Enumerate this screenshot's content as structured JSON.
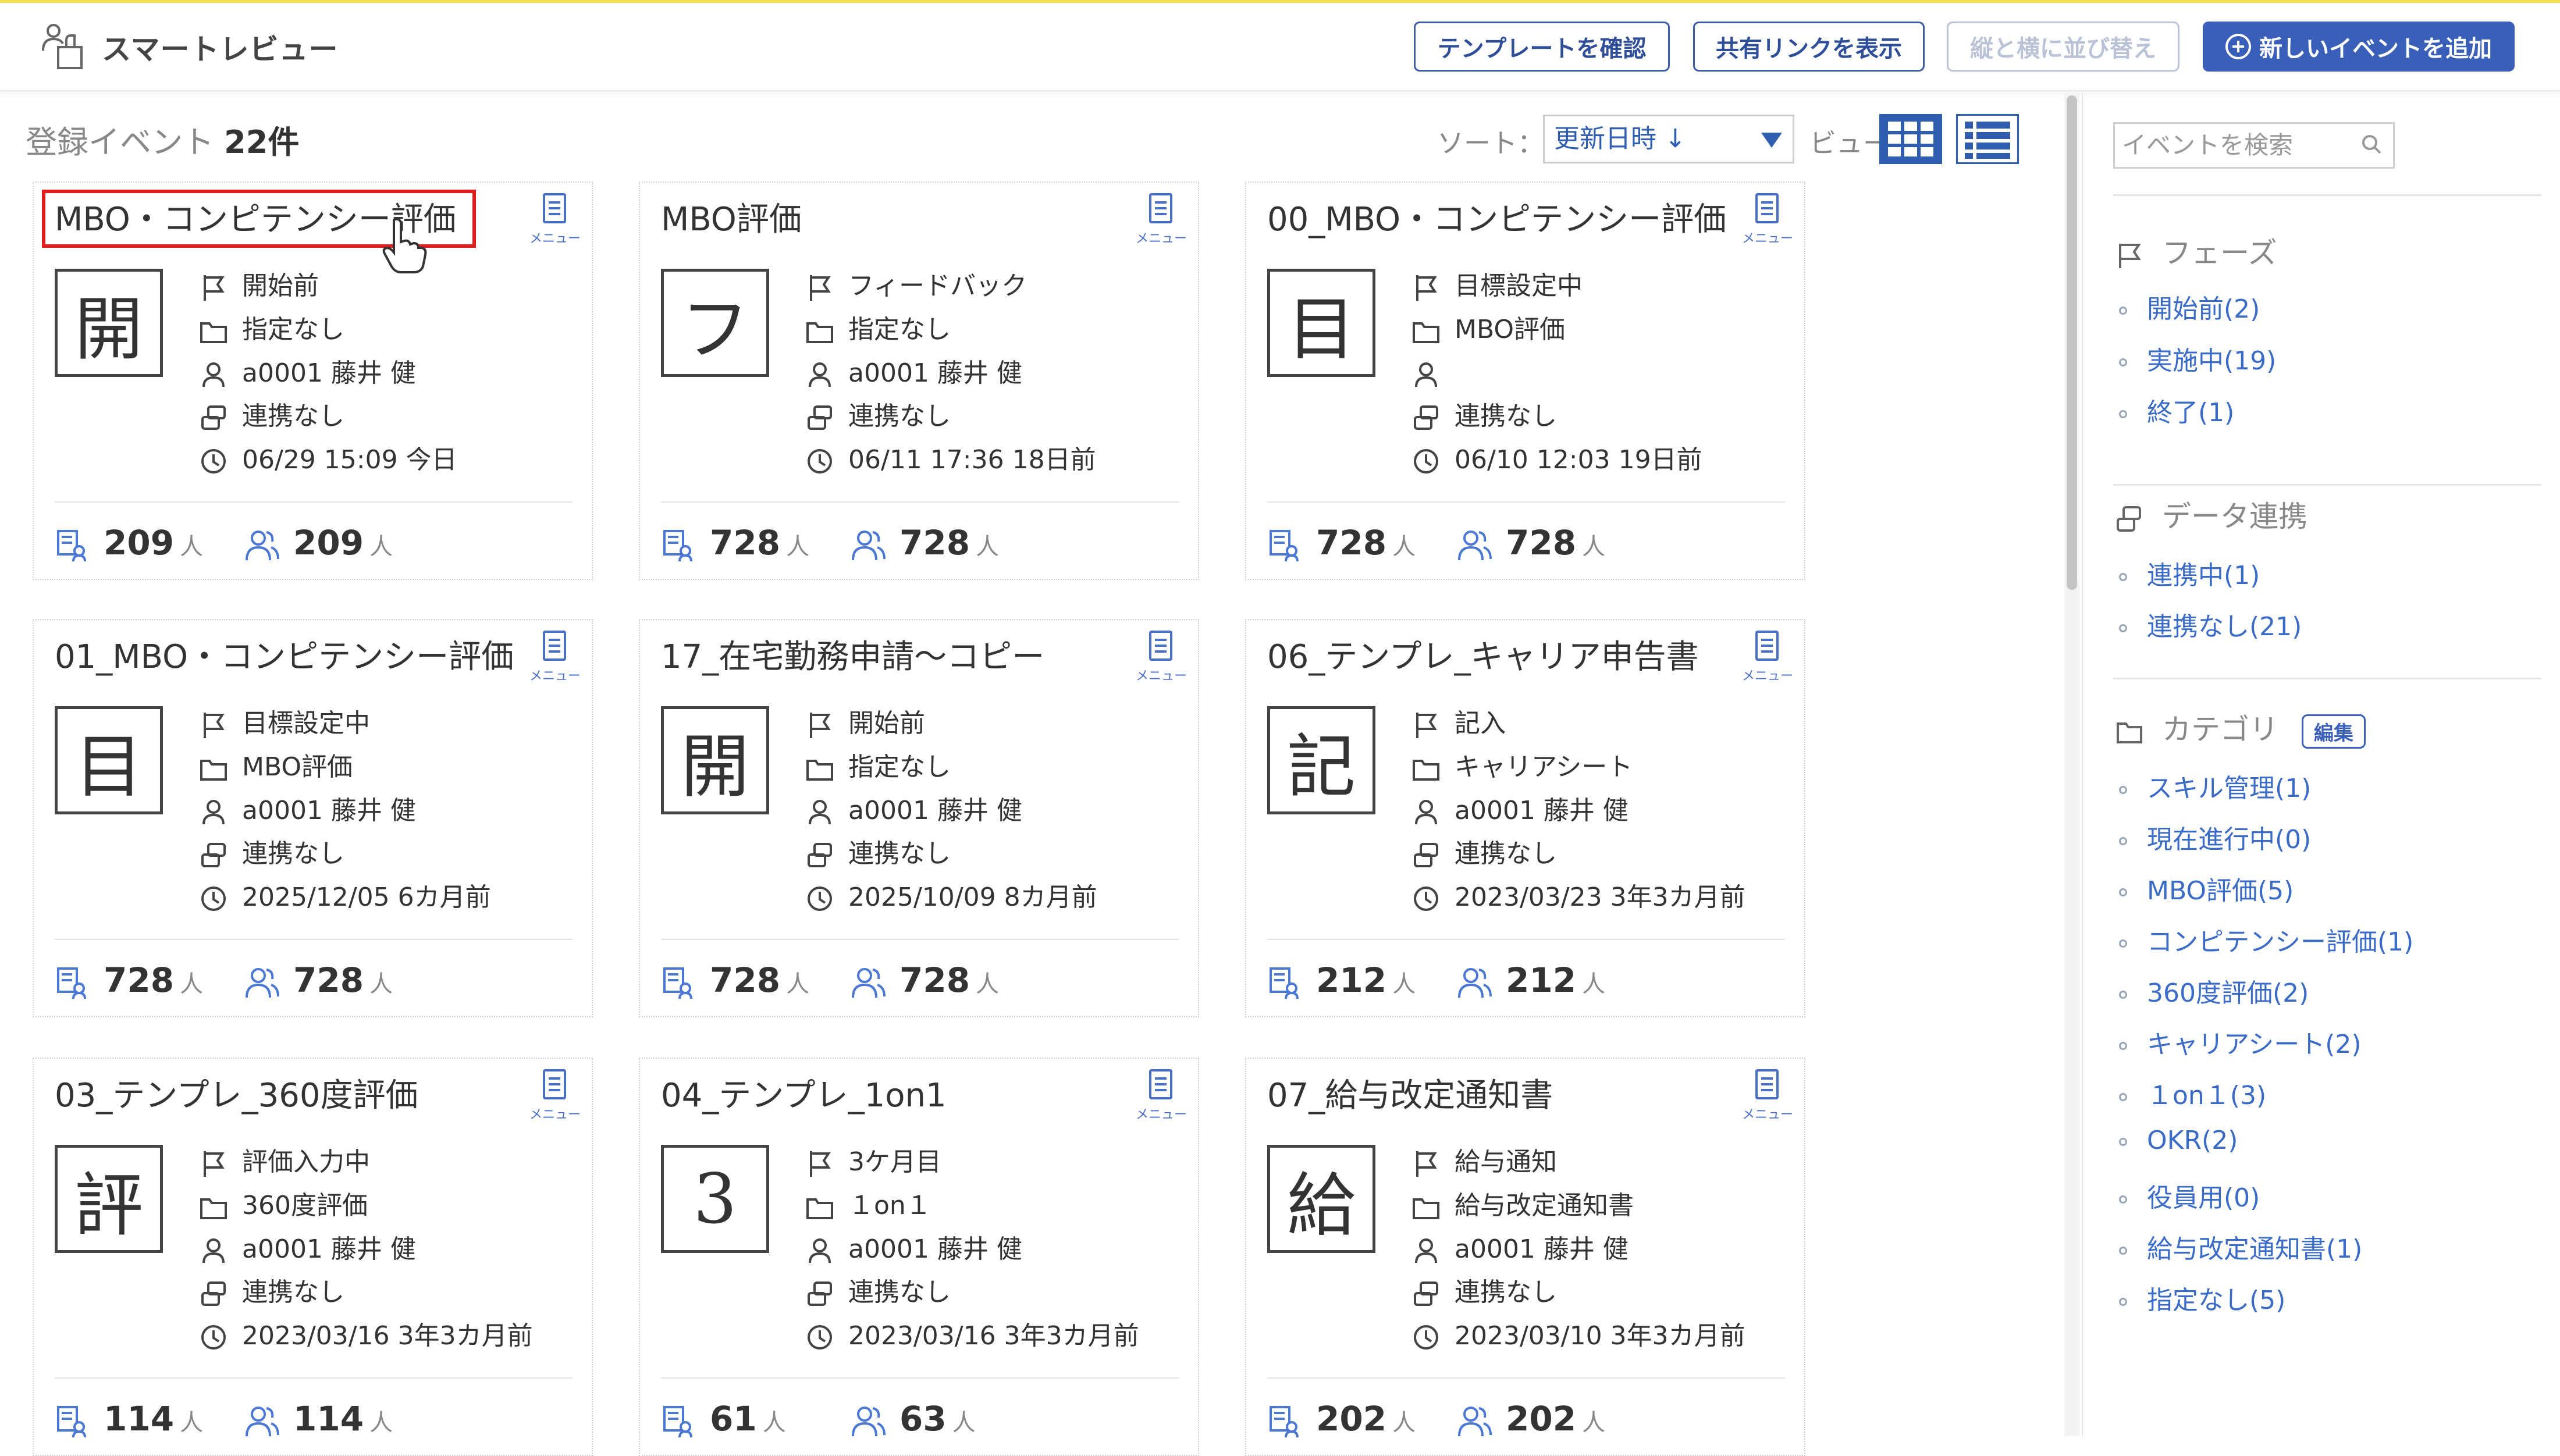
{
  "header": {
    "app_title": "スマートレビュー",
    "btn_template": "テンプレートを確認",
    "btn_share": "共有リンクを表示",
    "btn_sort_disabled": "縦と横に並び替え",
    "btn_add": "新しいイベントを追加"
  },
  "toolbar": {
    "count_prefix": "登録イベント",
    "count_value": "22件",
    "sort_label": "ソート：",
    "sort_value": "更新日時 ↓",
    "view_label": "ビュー："
  },
  "cards": [
    {
      "title": "MBO・コンピテンシー評価",
      "phase_char": "開",
      "phase": "開始前",
      "category": "指定なし",
      "owner": "a0001 藤井 健",
      "link": "連携なし",
      "updated": "06/29 15:09 今日",
      "target": "209",
      "reviewers": "209"
    },
    {
      "title": "MBO評価",
      "phase_char": "フ",
      "phase": "フィードバック",
      "category": "指定なし",
      "owner": "a0001 藤井 健",
      "link": "連携なし",
      "updated": "06/11 17:36 18日前",
      "target": "728",
      "reviewers": "728"
    },
    {
      "title": "00_MBO・コンピテンシー評価",
      "phase_char": "目",
      "phase": "目標設定中",
      "category": "MBO評価",
      "owner": "",
      "link": "連携なし",
      "updated": "06/10 12:03 19日前",
      "target": "728",
      "reviewers": "728"
    },
    {
      "title": "01_MBO・コンピテンシー評価",
      "phase_char": "目",
      "phase": "目標設定中",
      "category": "MBO評価",
      "owner": "a0001 藤井 健",
      "link": "連携なし",
      "updated": "2025/12/05 6カ月前",
      "target": "728",
      "reviewers": "728"
    },
    {
      "title": "17_在宅勤務申請～コピー",
      "phase_char": "開",
      "phase": "開始前",
      "category": "指定なし",
      "owner": "a0001 藤井 健",
      "link": "連携なし",
      "updated": "2025/10/09 8カ月前",
      "target": "728",
      "reviewers": "728"
    },
    {
      "title": "06_テンプレ_キャリア申告書",
      "phase_char": "記",
      "phase": "記入",
      "category": "キャリアシート",
      "owner": "a0001 藤井 健",
      "link": "連携なし",
      "updated": "2023/03/23 3年3カ月前",
      "target": "212",
      "reviewers": "212"
    },
    {
      "title": "03_テンプレ_360度評価",
      "phase_char": "評",
      "phase": "評価入力中",
      "category": "360度評価",
      "owner": "a0001 藤井 健",
      "link": "連携なし",
      "updated": "2023/03/16 3年3カ月前",
      "target": "114",
      "reviewers": "114"
    },
    {
      "title": "04_テンプレ_1on1",
      "phase_char": "3",
      "phase": "3ケ月目",
      "category": "１on１",
      "owner": "a0001 藤井 健",
      "link": "連携なし",
      "updated": "2023/03/16 3年3カ月前",
      "target": "61",
      "reviewers": "63"
    },
    {
      "title": "07_給与改定通知書",
      "phase_char": "給",
      "phase": "給与通知",
      "category": "給与改定通知書",
      "owner": "a0001 藤井 健",
      "link": "連携なし",
      "updated": "2023/03/10 3年3カ月前",
      "target": "202",
      "reviewers": "202"
    }
  ],
  "card_labels": {
    "menu": "メニュー",
    "unit": "人"
  },
  "sidebar": {
    "search_placeholder": "イベントを検索",
    "phase_title": "フェーズ",
    "phase_items": [
      "開始前(2)",
      "実施中(19)",
      "終了(1)"
    ],
    "link_title": "データ連携",
    "link_items": [
      "連携中(1)",
      "連携なし(21)"
    ],
    "category_title": "カテゴリ",
    "edit_label": "編集",
    "category_items": [
      "スキル管理(1)",
      "現在進行中(0)",
      "MBO評価(5)",
      "コンピテンシー評価(1)",
      "360度評価(2)",
      "キャリアシート(2)",
      "１on１(3)",
      "OKR(2)",
      "役員用(0)",
      "給与改定通知書(1)",
      "指定なし(5)"
    ]
  }
}
